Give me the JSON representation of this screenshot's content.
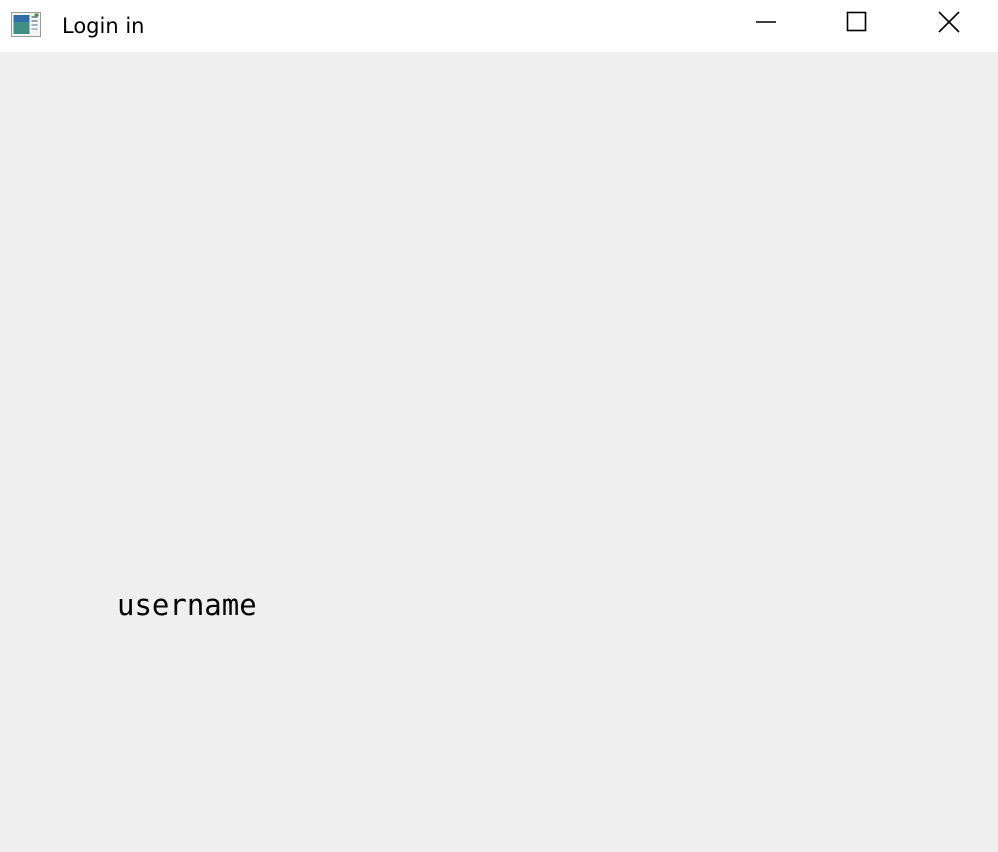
{
  "window": {
    "title": "Login in",
    "app_icon": "application-window-icon",
    "controls": {
      "minimize_icon": "minimize-icon",
      "maximize_icon": "maximize-icon",
      "close_icon": "close-icon"
    }
  },
  "form": {
    "username_label": "username"
  },
  "colors": {
    "titlebar": "#ffffff",
    "client_background": "#efefef",
    "text": "#000000"
  }
}
